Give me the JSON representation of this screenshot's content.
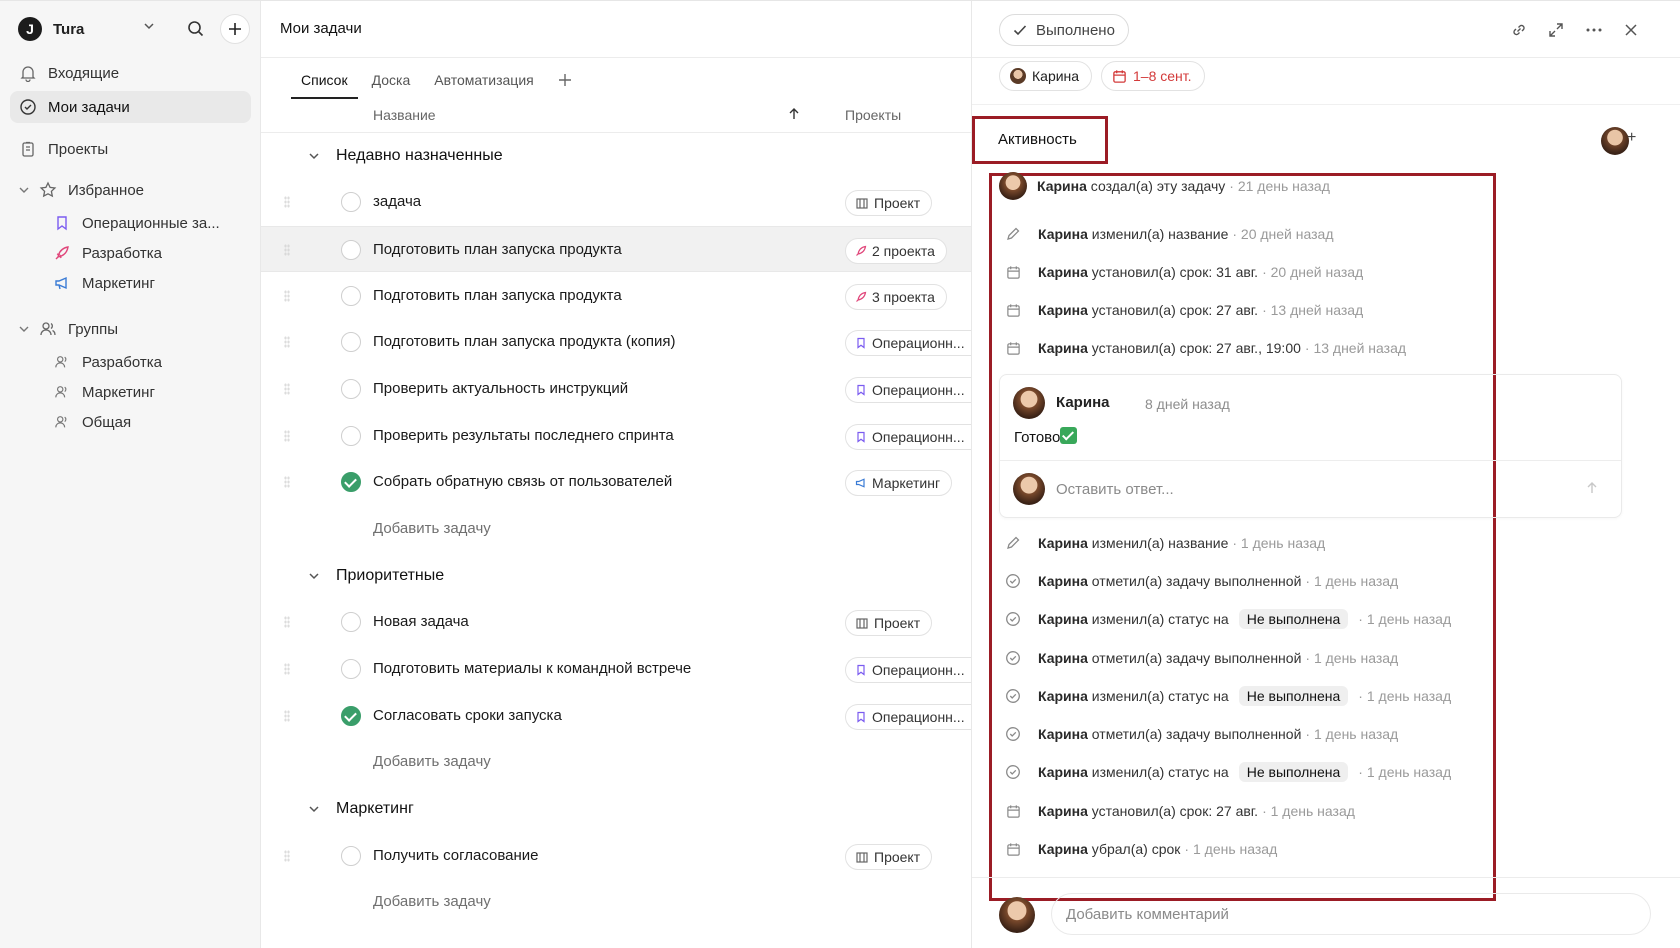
{
  "sidebar": {
    "brand": "Tura",
    "nav": [
      {
        "label": "Входящие"
      },
      {
        "label": "Мои задачи"
      },
      {
        "label": "Проекты"
      }
    ],
    "favorites": {
      "label": "Избранное",
      "items": [
        {
          "label": "Операционные за..."
        },
        {
          "label": "Разработка"
        },
        {
          "label": "Маркетинг"
        }
      ]
    },
    "groups": {
      "label": "Группы",
      "items": [
        {
          "label": "Разработка"
        },
        {
          "label": "Маркетинг"
        },
        {
          "label": "Общая"
        }
      ]
    }
  },
  "main": {
    "title": "Мои задачи",
    "tabs": [
      "Список",
      "Доска",
      "Автоматизация"
    ],
    "columns": {
      "name": "Название",
      "projects": "Проекты"
    },
    "groups": [
      {
        "name": "Недавно назначенные",
        "tasks": [
          {
            "name": "задача",
            "project": "Проект",
            "done": false
          },
          {
            "name": "Подготовить план запуска продукта",
            "project": "2 проекта",
            "done": false
          },
          {
            "name": "Подготовить план запуска продукта",
            "project": "3 проекта",
            "done": false
          },
          {
            "name": "Подготовить план запуска продукта (копия)",
            "project": "Операционн...",
            "done": false
          },
          {
            "name": "Проверить актуальность инструкций",
            "project": "Операционн...",
            "done": false
          },
          {
            "name": "Проверить результаты последнего спринта",
            "project": "Операционн...",
            "done": false
          },
          {
            "name": "Собрать обратную связь от пользователей",
            "project": "Маркетинг",
            "done": true
          }
        ]
      },
      {
        "name": "Приоритетные",
        "tasks": [
          {
            "name": "Новая задача",
            "project": "Проект",
            "done": false
          },
          {
            "name": "Подготовить материалы к командной встрече",
            "project": "Операционн...",
            "done": false
          },
          {
            "name": "Согласовать сроки запуска",
            "project": "Операционн...",
            "done": true
          }
        ]
      },
      {
        "name": "Маркетинг",
        "tasks": [
          {
            "name": "Получить согласование",
            "project": "Проект",
            "done": false
          }
        ]
      }
    ],
    "add_task": "Добавить задачу"
  },
  "panel": {
    "done_label": "Выполнено",
    "assignee": "Карина",
    "date": "1–8 сент.",
    "activity_title": "Активность",
    "events_top": [
      {
        "who": "Карина",
        "what": "создал(а) эту задачу",
        "when": "· 21 день назад"
      },
      {
        "who": "Карина",
        "what": "изменил(а) название",
        "when": "· 20 дней назад"
      },
      {
        "who": "Карина",
        "what": "установил(а) срок: 31 авг.",
        "when": "· 20 дней назад"
      },
      {
        "who": "Карина",
        "what": "установил(а) срок: 27 авг.",
        "when": "· 13 дней назад"
      },
      {
        "who": "Карина",
        "what": "установил(а) срок: 27 авг., 19:00",
        "when": "· 13 дней назад"
      }
    ],
    "comment": {
      "author": "Карина",
      "time": "8 дней назад",
      "text": "Готово",
      "reply_placeholder": "Оставить ответ..."
    },
    "events_bottom": [
      {
        "who": "Карина",
        "what": "изменил(а) название",
        "when": "· 1 день назад"
      },
      {
        "who": "Карина",
        "what": "отметил(а) задачу выполненной",
        "when": "· 1 день назад"
      },
      {
        "who": "Карина",
        "what": "изменил(а) статус на",
        "badge": "Не выполнена",
        "when": "· 1 день назад"
      },
      {
        "who": "Карина",
        "what": "отметил(а) задачу выполненной",
        "when": "· 1 день назад"
      },
      {
        "who": "Карина",
        "what": "изменил(а) статус на",
        "badge": "Не выполнена",
        "when": "· 1 день назад"
      },
      {
        "who": "Карина",
        "what": "отметил(а) задачу выполненной",
        "when": "· 1 день назад"
      },
      {
        "who": "Карина",
        "what": "изменил(а) статус на",
        "badge": "Не выполнена",
        "when": "· 1 день назад"
      },
      {
        "who": "Карина",
        "what": "установил(а) срок: 27 авг.",
        "when": "· 1 день назад"
      },
      {
        "who": "Карина",
        "what": "убрал(а) срок",
        "when": "· 1 день назад"
      }
    ],
    "comment_placeholder": "Добавить комментарий"
  },
  "colors": {
    "accent_done": "#3a9e6a",
    "date_red": "#d33a3a",
    "highlight_box": "#9b1c25"
  }
}
